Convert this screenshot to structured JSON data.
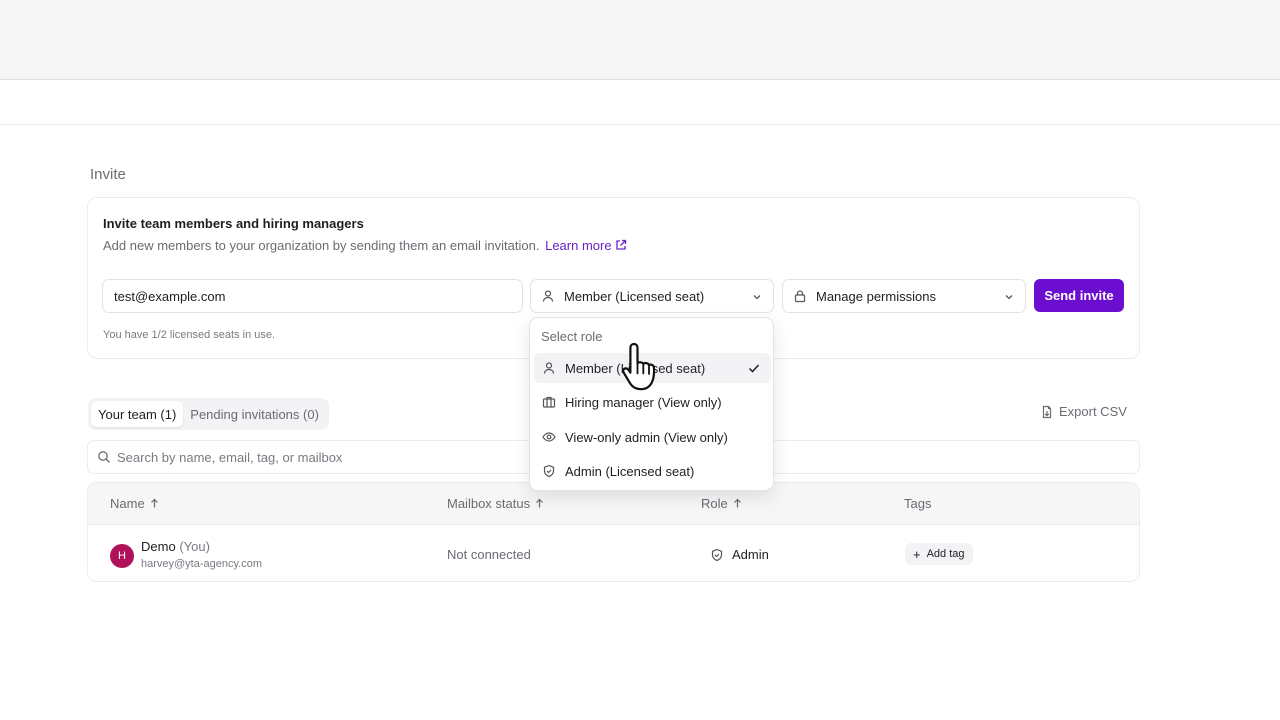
{
  "section": {
    "title": "Invite"
  },
  "invite_card": {
    "title": "Invite team members and hiring managers",
    "description": "Add new members to your organization by sending them an email invitation.",
    "learn_more": "Learn more",
    "email_value": "test@example.com",
    "role_selected": "Member (Licensed seat)",
    "permissions_label": "Manage permissions",
    "send_label": "Send invite",
    "seats_note": "You have 1/2 licensed seats in use."
  },
  "tabs": [
    {
      "label": "Your team (1)",
      "active": true
    },
    {
      "label": "Pending invitations (0)",
      "active": false
    }
  ],
  "export_label": "Export CSV",
  "search": {
    "placeholder": "Search by name, email, tag, or mailbox"
  },
  "table": {
    "columns": [
      "Name",
      "Mailbox status",
      "Role",
      "Tags"
    ],
    "rows": [
      {
        "avatar_initial": "H",
        "name": "Demo",
        "you_label": "(You)",
        "email": "harvey@yta-agency.com",
        "mailbox_status": "Not connected",
        "role": "Admin",
        "add_tag": "Add tag"
      }
    ]
  },
  "role_dropdown": {
    "header": "Select role",
    "options": [
      {
        "label": "Member (Licensed seat)",
        "icon": "user-icon",
        "selected": true
      },
      {
        "label": "Hiring manager (View only)",
        "icon": "briefcase-icon",
        "selected": false
      },
      {
        "label": "View-only admin (View only)",
        "icon": "eye-icon",
        "selected": false
      },
      {
        "label": "Admin (Licensed seat)",
        "icon": "shield-icon",
        "selected": false
      }
    ]
  },
  "colors": {
    "accent": "#6b0ecf",
    "link": "#6b21c8",
    "avatar": "#b0125a"
  }
}
